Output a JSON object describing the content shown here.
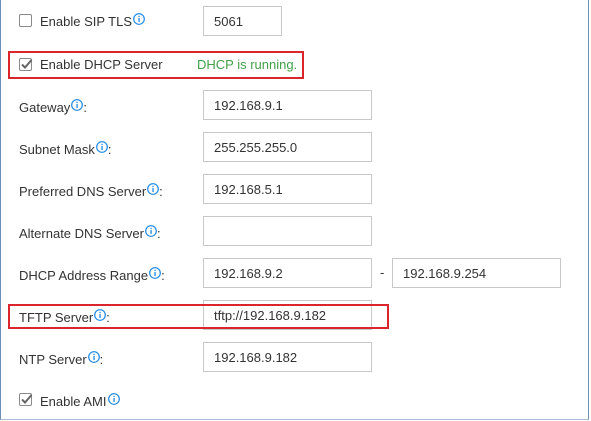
{
  "sip_tls": {
    "label": "Enable SIP TLS",
    "checked": false,
    "port_value": "5061"
  },
  "dhcp": {
    "label": "Enable DHCP Server",
    "checked": true,
    "status": "DHCP is running."
  },
  "fields": {
    "gateway": {
      "label": "Gateway",
      "value": "192.168.9.1"
    },
    "subnet_mask": {
      "label": "Subnet Mask",
      "value": "255.255.255.0"
    },
    "preferred_dns": {
      "label": "Preferred DNS Server",
      "value": "192.168.5.1"
    },
    "alternate_dns": {
      "label": "Alternate DNS Server",
      "value": ""
    },
    "dhcp_range": {
      "label": "DHCP Address Range",
      "start": "192.168.9.2",
      "separator": "-",
      "end": "192.168.9.254"
    },
    "tftp_server": {
      "label": "TFTP Server",
      "value": "tftp://192.168.9.182"
    },
    "ntp_server": {
      "label": "NTP Server",
      "value": "192.168.9.182"
    }
  },
  "ami": {
    "label": "Enable AMI",
    "checked": true
  },
  "colon": ":",
  "colors": {
    "info_icon": "#1e88e5",
    "highlight_border": "#d9252b",
    "status_text": "#43a047"
  },
  "icons": {
    "info": "info-icon",
    "checkbox_checked": "checkmark-icon"
  }
}
